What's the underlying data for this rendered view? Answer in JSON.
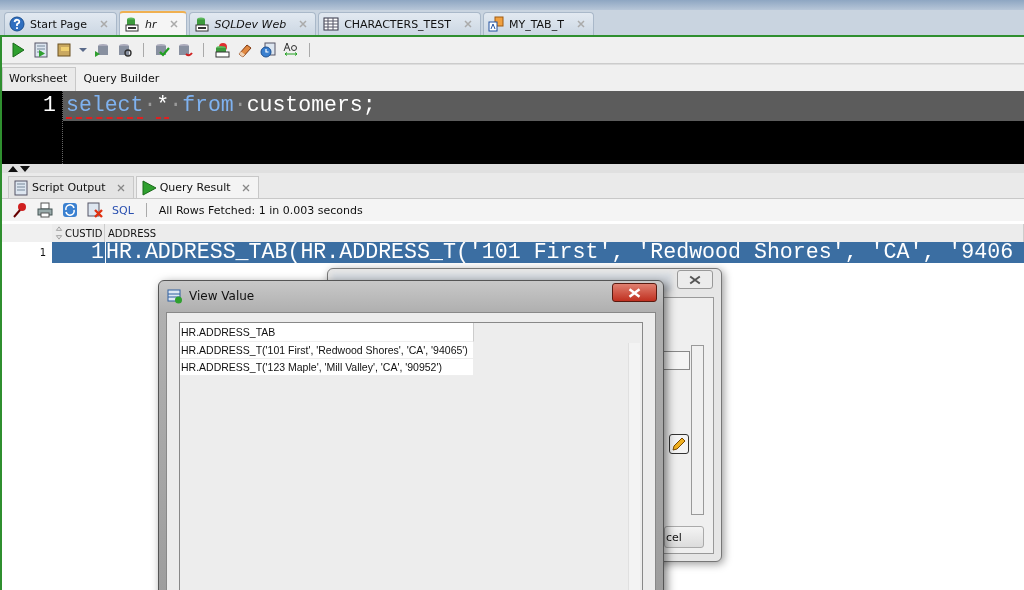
{
  "document_tabs": [
    {
      "label": "Start Page",
      "kind": "help",
      "italic": false,
      "selected": false
    },
    {
      "label": "hr",
      "kind": "sql",
      "italic": true,
      "selected": true
    },
    {
      "label": "SQLDev Web",
      "kind": "sql",
      "italic": true,
      "selected": false
    },
    {
      "label": "CHARACTERS_TEST",
      "kind": "table",
      "italic": false,
      "selected": false
    },
    {
      "label": "MY_TAB_T",
      "kind": "type",
      "italic": false,
      "selected": false
    }
  ],
  "editor_tabs": [
    {
      "label": "Worksheet",
      "selected": true
    },
    {
      "label": "Query Builder",
      "selected": false
    }
  ],
  "editor": {
    "line_number": "1",
    "tokens": [
      {
        "text": "select",
        "kind": "keyword",
        "flagged": true
      },
      {
        "text": "·",
        "kind": "space",
        "flagged": false
      },
      {
        "text": "*",
        "kind": "plain",
        "flagged": true
      },
      {
        "text": "·",
        "kind": "space",
        "flagged": false
      },
      {
        "text": "from",
        "kind": "keyword",
        "flagged": false
      },
      {
        "text": "·",
        "kind": "space",
        "flagged": false
      },
      {
        "text": "customers;",
        "kind": "plain",
        "flagged": false
      }
    ]
  },
  "result_tabs": [
    {
      "label": "Script Output",
      "kind": "script",
      "selected": false
    },
    {
      "label": "Query Result",
      "kind": "query",
      "selected": true
    }
  ],
  "result_toolbar": {
    "sql_link": "SQL",
    "status": "All Rows Fetched: 1 in 0.003 seconds"
  },
  "grid": {
    "columns": [
      "CUSTID",
      "ADDRESS"
    ],
    "rows": [
      {
        "row_number": "1",
        "cells": [
          "1",
          "HR.ADDRESS_TAB(HR.ADDRESS_T('101 First', 'Redwood Shores', 'CA', '9406"
        ],
        "selected": true
      }
    ]
  },
  "record_dialog": {
    "button": "cel"
  },
  "view_value_dialog": {
    "title": "View Value",
    "items": [
      {
        "text": "HR.ADDRESS_TAB",
        "kind": "header"
      },
      {
        "text": "HR.ADDRESS_T('101 First', 'Redwood Shores', 'CA', '94065')",
        "kind": "item"
      },
      {
        "text": "HR.ADDRESS_T('123 Maple', 'Mill Valley', 'CA', '90952')",
        "kind": "item"
      }
    ]
  }
}
